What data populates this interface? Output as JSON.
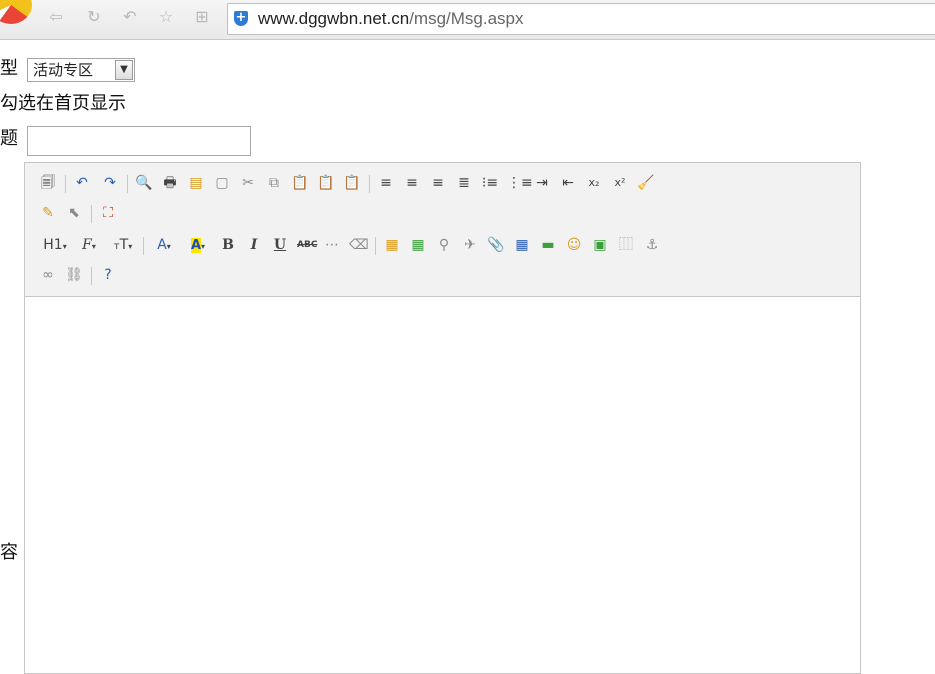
{
  "browser": {
    "url_domain": "www.dggwbn.net.cn",
    "url_path": "/msg/Msg.aspx",
    "nav_icons": [
      "back-arrow-icon",
      "refresh-icon",
      "undo-history-icon",
      "favorite-star-icon",
      "grid-apps-icon"
    ]
  },
  "form": {
    "type_label": "型",
    "type_value": "活动专区",
    "homepage_label": "勾选在首页显示",
    "title_label": "题",
    "title_value": "",
    "content_label": "容"
  },
  "toolbar": {
    "h1_label": "H1",
    "bold": "B",
    "italic": "I",
    "underline": "U",
    "abc": "ABC",
    "font_color": "A",
    "highlight": "A",
    "font_family": "F",
    "font_size": "T"
  }
}
